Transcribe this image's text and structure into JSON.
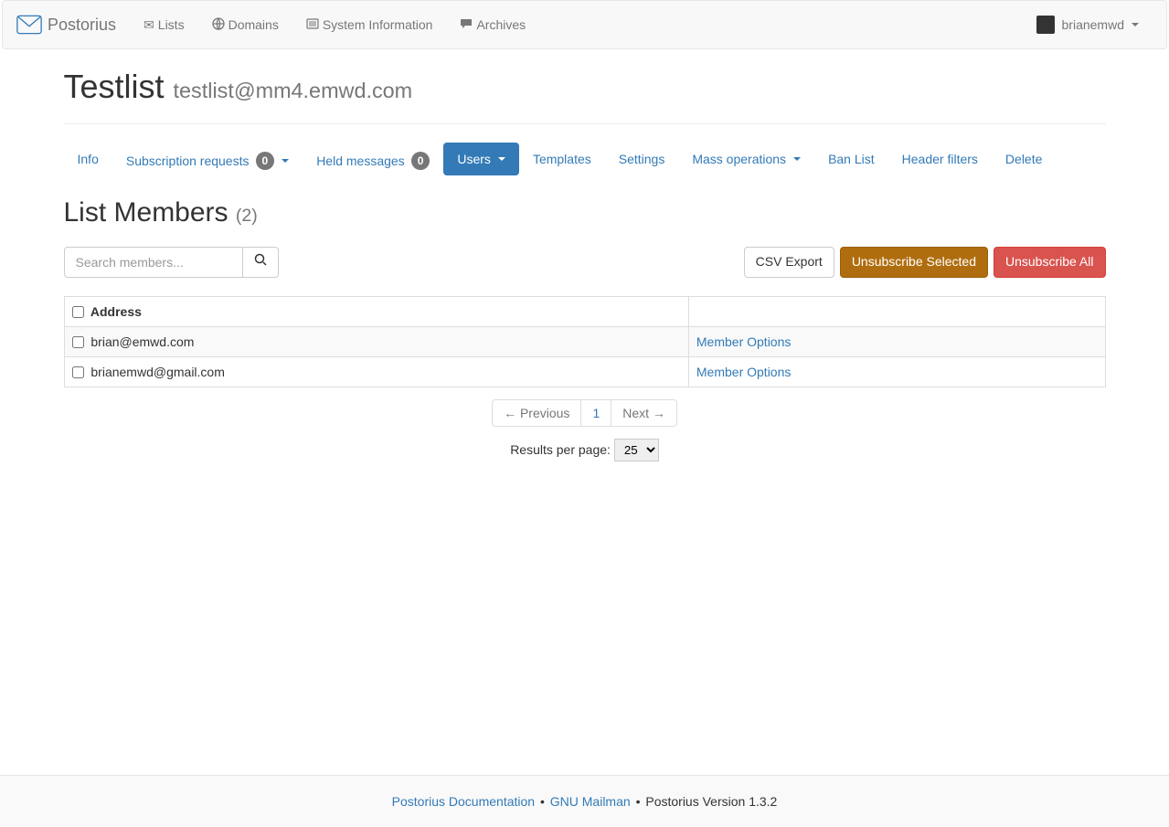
{
  "navbar": {
    "brand": "Postorius",
    "items": [
      {
        "icon": "envelope",
        "label": "Lists"
      },
      {
        "icon": "globe",
        "label": "Domains"
      },
      {
        "icon": "list-alt",
        "label": "System Information"
      },
      {
        "icon": "comment",
        "label": "Archives"
      }
    ],
    "user": "brianemwd"
  },
  "header": {
    "list_name": "Testlist",
    "list_address": "testlist@mm4.emwd.com"
  },
  "tabs": {
    "info": "Info",
    "subscription_requests": "Subscription requests",
    "subscription_requests_count": "0",
    "held_messages": "Held messages",
    "held_messages_count": "0",
    "users": "Users",
    "templates": "Templates",
    "settings": "Settings",
    "mass_operations": "Mass operations",
    "ban_list": "Ban List",
    "header_filters": "Header filters",
    "delete": "Delete"
  },
  "section": {
    "title": "List Members",
    "count_display": "(2)"
  },
  "search": {
    "placeholder": "Search members..."
  },
  "actions": {
    "csv_export": "CSV Export",
    "unsubscribe_selected": "Unsubscribe Selected",
    "unsubscribe_all": "Unsubscribe All"
  },
  "table": {
    "header_address": "Address",
    "member_options": "Member Options",
    "rows": [
      {
        "address": "brian@emwd.com"
      },
      {
        "address": "brianemwd@gmail.com"
      }
    ]
  },
  "pagination": {
    "previous": "← Previous",
    "current": "1",
    "next": "Next →",
    "results_per_page_label": "Results per page:",
    "results_per_page_value": "25"
  },
  "footer": {
    "doc_link": "Postorius Documentation",
    "mailman_link": "GNU Mailman",
    "version_text": "Postorius Version 1.3.2"
  }
}
